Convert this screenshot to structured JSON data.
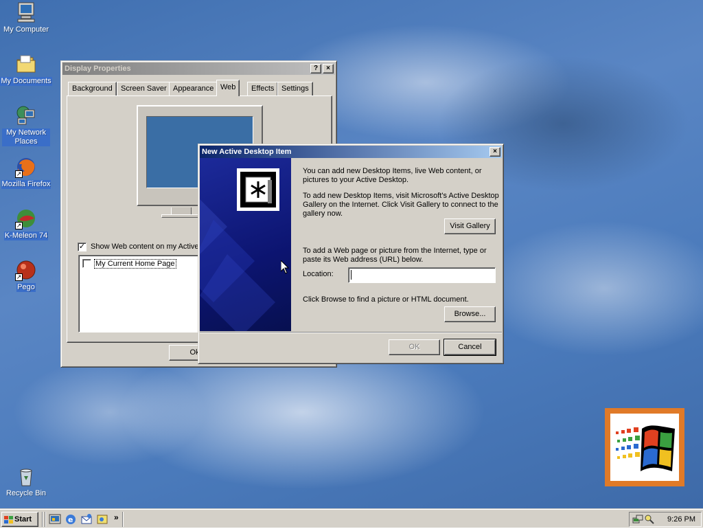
{
  "desktop": {
    "icons": [
      {
        "label": "My Computer"
      },
      {
        "label": "My Documents"
      },
      {
        "label": "My Network Places"
      },
      {
        "label": "Mozilla Firefox"
      },
      {
        "label": "K-Meleon 74"
      },
      {
        "label": "Pego"
      },
      {
        "label": "Recycle Bin"
      }
    ]
  },
  "display_properties": {
    "title": "Display Properties",
    "help_button": "?",
    "close_button": "×",
    "tabs": [
      {
        "label": "Background"
      },
      {
        "label": "Screen Saver"
      },
      {
        "label": "Appearance"
      },
      {
        "label": "Web",
        "active": true
      },
      {
        "label": "Effects"
      },
      {
        "label": "Settings"
      }
    ],
    "show_web_content_label": "Show Web content on my Active",
    "show_web_content_checked": true,
    "items": [
      {
        "label": "My Current Home Page",
        "checked": false
      }
    ],
    "ok_label": "Ok"
  },
  "new_item_dialog": {
    "title": "New Active Desktop Item",
    "close_button": "×",
    "intro_text": "You can add new Desktop Items, live Web content, or pictures to your Active Desktop.",
    "gallery_text": "To add new Desktop Items, visit Microsoft's Active Desktop Gallery on the Internet. Click Visit Gallery to connect to the gallery now.",
    "visit_gallery_label": "Visit Gallery",
    "url_text": "To add a Web page or picture from the Internet, type or paste its Web address (URL) below.",
    "location_label": "Location:",
    "location_value": "",
    "browse_text": "Click Browse to find a picture or HTML document.",
    "browse_label": "Browse...",
    "ok_label": "OK",
    "cancel_label": "Cancel"
  },
  "taskbar": {
    "start_label": "Start",
    "quick_launch": [
      "desktop-icon",
      "internet-explorer-icon",
      "outlook-express-icon",
      "media-icon"
    ],
    "chevron": "»",
    "clock": "9:26 PM"
  },
  "colors": {
    "title_active": "#0a246a",
    "title_inactive": "#808080",
    "face": "#d4d0c8",
    "desktop": "#4a7abb"
  }
}
